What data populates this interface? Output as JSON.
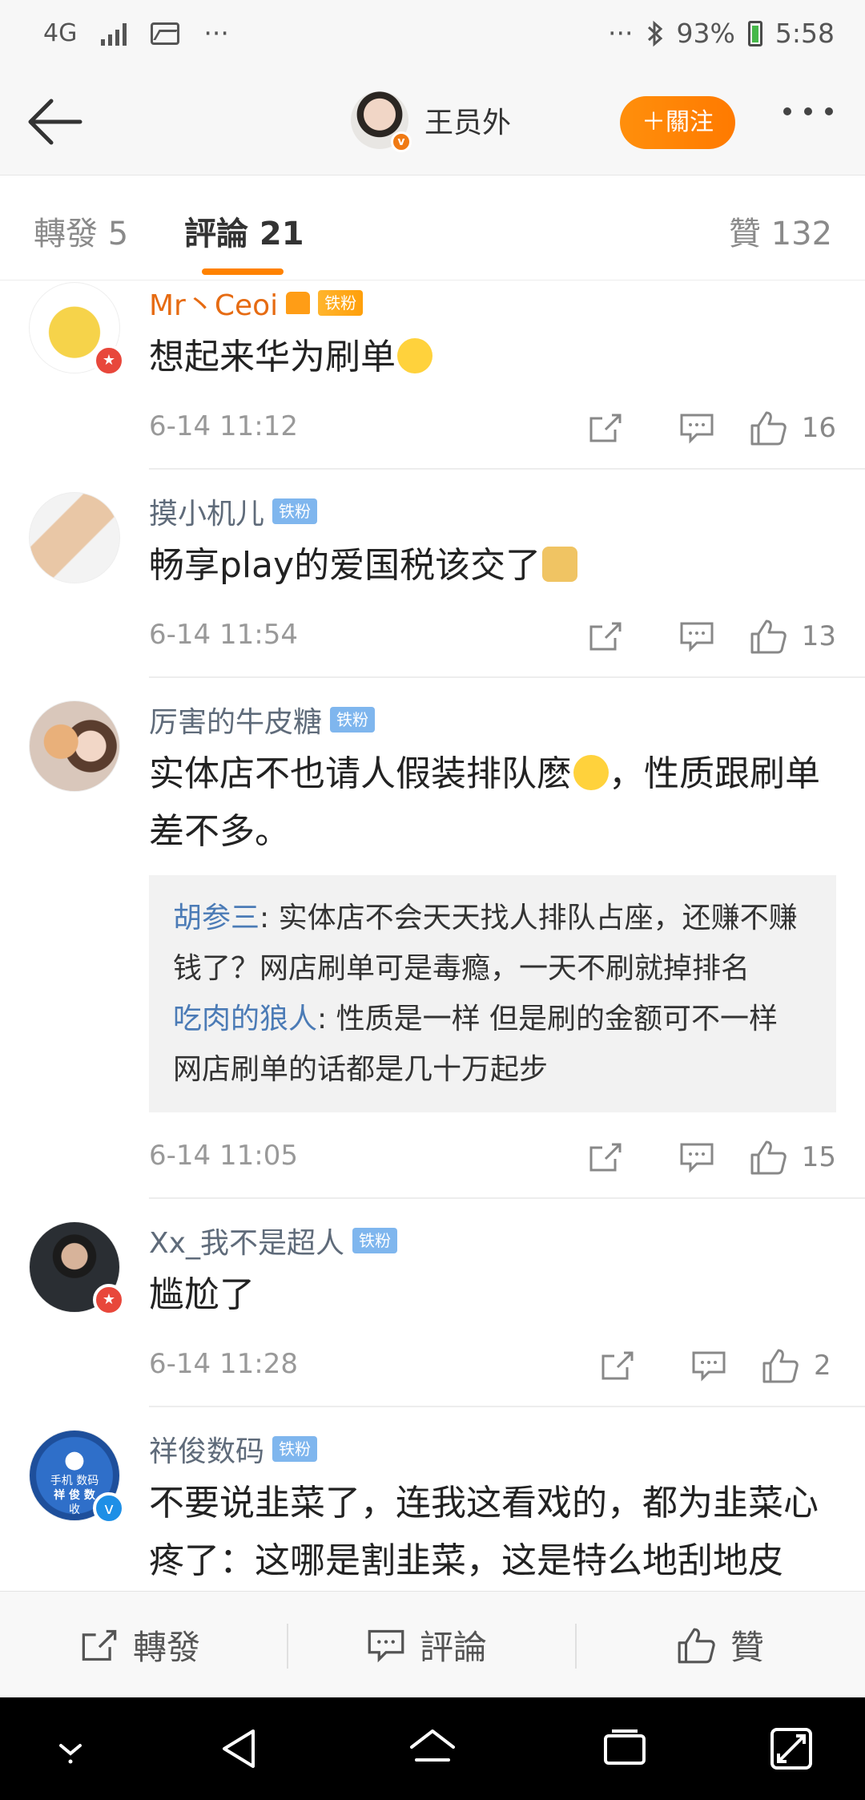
{
  "status_bar": {
    "network": "4G",
    "more_left": "···",
    "more_right": "···",
    "battery": "93%",
    "time": "5:58"
  },
  "header": {
    "user_name": "王员外",
    "follow_label": "＋關注"
  },
  "tabs": {
    "repost": "轉發 5",
    "comments": "評論 21",
    "likes": "贊 132"
  },
  "comments": [
    {
      "name": "Mr丶Ceoi",
      "badge": "铁粉",
      "text": "想起来华为刷单",
      "time": "6-14 11:12",
      "likes": "16"
    },
    {
      "name": "摸小机儿",
      "badge": "铁粉",
      "text": "畅享play的爱国税该交了",
      "time": "6-14 11:54",
      "likes": "13"
    },
    {
      "name": "厉害的牛皮糖",
      "badge": "铁粉",
      "text_a": "实体店不也请人假装排队麽",
      "text_b": "，性质跟刷单差不多。",
      "replies": [
        {
          "name": "胡参三",
          "text": ": 实体店不会天天找人排队占座，还赚不赚钱了？网店刷单可是毒瘾，一天不刷就掉排名"
        },
        {
          "name": "吃肉的狼人",
          "text": ": 性质是一样 但是刷的金额可不一样 网店刷单的话都是几十万起步"
        }
      ],
      "time": "6-14 11:05",
      "likes": "15"
    },
    {
      "name": "Xx_我不是超人",
      "badge": "铁粉",
      "text": "尴尬了",
      "time": "6-14 11:28",
      "likes": "2"
    },
    {
      "name": "祥俊数码",
      "badge": "铁粉",
      "text": "不要说韭菜了，连我这看戏的，都为韭菜心疼了：这哪是割韭菜，这是特么地刮地皮"
    }
  ],
  "avatar5_text": {
    "line1": "手机",
    "line2": "数码",
    "line3": "祥 俊 数",
    "line4": "收"
  },
  "bottom_bar": {
    "repost": "轉發",
    "comment": "評論",
    "like": "贊"
  },
  "colors": {
    "accent": "#ff8200",
    "name_orange": "#e66b12",
    "reply_name": "#4b7bb6",
    "fan_badge": "#7fb6ee"
  }
}
